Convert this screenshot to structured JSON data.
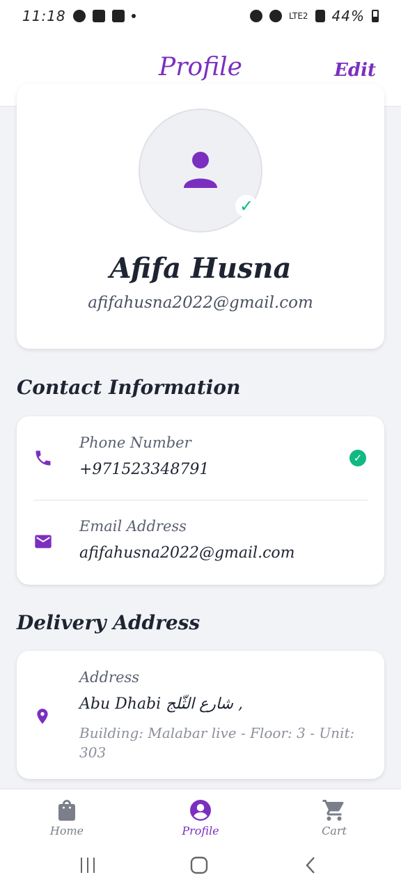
{
  "status_bar": {
    "time": "11:18",
    "network_label": "LTE2",
    "battery": "44%"
  },
  "header": {
    "title": "Profile",
    "edit_label": "Edit"
  },
  "profile": {
    "name": "Afifa Husna",
    "email": "afifahusna2022@gmail.com",
    "verified_icon": "check-icon",
    "avatar_icon": "person-icon"
  },
  "contact": {
    "section_title": "Contact Information",
    "phone": {
      "label": "Phone Number",
      "value": "+971523348791",
      "icon": "phone-icon",
      "status_icon": "check-circle-icon"
    },
    "email": {
      "label": "Email Address",
      "value": "afifahusna2022@gmail.com",
      "icon": "mail-icon"
    }
  },
  "delivery": {
    "section_title": "Delivery Address",
    "address_label": "Address",
    "address_line": "Abu Dhabi شارع الثّلج ,",
    "address_details": "Building: Malabar live - Floor: 3 - Unit: 303",
    "icon": "location-pin-icon"
  },
  "bottom_nav": {
    "items": [
      {
        "label": "Home",
        "icon": "shopping-bag-icon",
        "active": false
      },
      {
        "label": "Profile",
        "icon": "account-circle-icon",
        "active": true
      },
      {
        "label": "Cart",
        "icon": "cart-icon",
        "active": false
      }
    ]
  },
  "colors": {
    "accent": "#7b2fbf",
    "success": "#10b981",
    "background": "#f1f3f6",
    "text": "#1f2433",
    "muted": "#8a8f9a"
  }
}
